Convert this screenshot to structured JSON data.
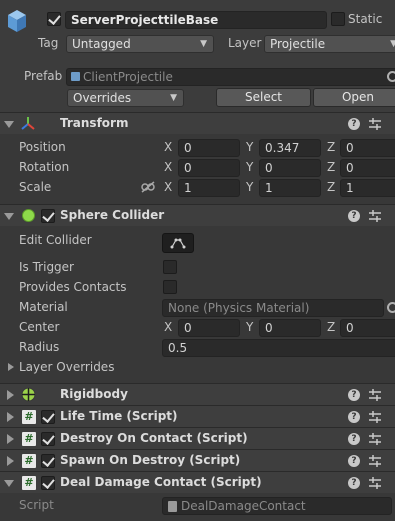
{
  "object": {
    "name": "ServerProjecttileBase",
    "static_label": "Static",
    "tag_label": "Tag",
    "tag_value": "Untagged",
    "layer_label": "Layer",
    "layer_value": "Projectile",
    "prefab_label": "Prefab",
    "prefab_value": "ClientProjectile",
    "overrides_label": "Overrides",
    "select_label": "Select",
    "open_label": "Open"
  },
  "transform": {
    "title": "Transform",
    "rows": [
      {
        "label": "Position",
        "x": "0",
        "y": "0.347",
        "z": "0"
      },
      {
        "label": "Rotation",
        "x": "0",
        "y": "0",
        "z": "0"
      },
      {
        "label": "Scale",
        "x": "1",
        "y": "1",
        "z": "1"
      }
    ],
    "axis_x": "X",
    "axis_y": "Y",
    "axis_z": "Z"
  },
  "sphere_collider": {
    "title": "Sphere Collider",
    "edit_collider_label": "Edit Collider",
    "is_trigger_label": "Is Trigger",
    "provides_contacts_label": "Provides Contacts",
    "material_label": "Material",
    "material_value": "None (Physics Material)",
    "center_label": "Center",
    "center": {
      "x": "0",
      "y": "0",
      "z": "0"
    },
    "radius_label": "Radius",
    "radius_value": "0.5",
    "layer_overrides_label": "Layer Overrides"
  },
  "components": {
    "rigidbody": "Rigidbody",
    "life_time": "Life Time (Script)",
    "destroy_on_contact": "Destroy On Contact (Script)",
    "spawn_on_destroy": "Spawn On Destroy (Script)",
    "deal_damage_contact": "Deal Damage Contact (Script)"
  },
  "deal_damage": {
    "script_label": "Script",
    "script_value": "DealDamageContact"
  },
  "icons": {
    "help": "?",
    "script_glyph": "#"
  },
  "colors": {
    "background": "#383838",
    "header": "#3e3e3e",
    "field": "#2a2a2a",
    "transform_red": "#e0463a",
    "transform_green": "#6bc24a",
    "transform_blue": "#3a7ae0",
    "collider_green": "#8ed94a"
  }
}
